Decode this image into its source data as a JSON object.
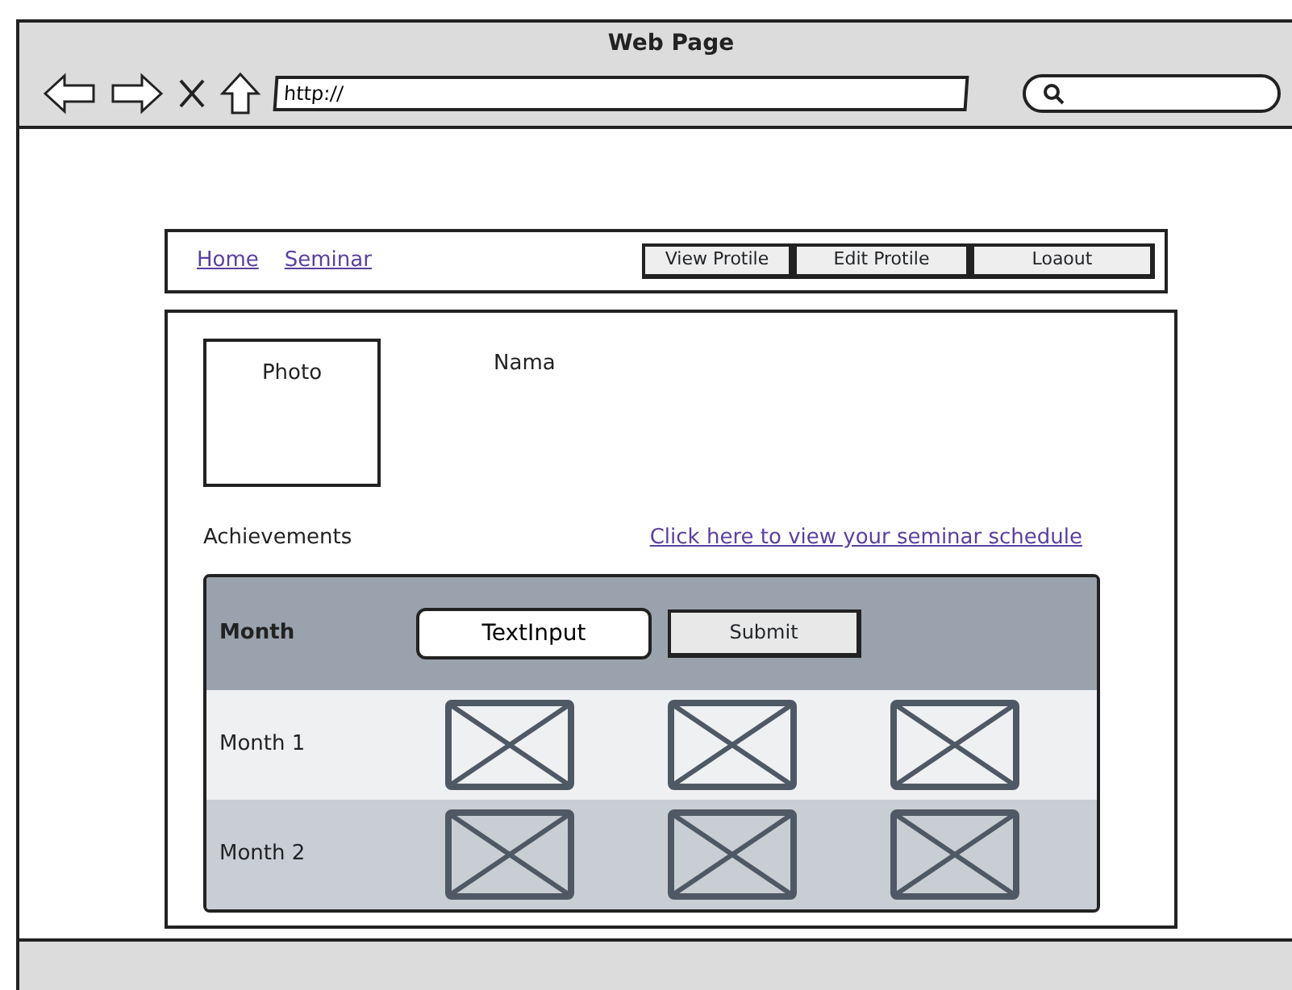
{
  "window": {
    "title": "Web Page",
    "url": "http://"
  },
  "nav": {
    "links": [
      {
        "label": "Home"
      },
      {
        "label": "Seminar"
      }
    ],
    "buttons": [
      "View Protile",
      "Edit Protile",
      "Loaout"
    ]
  },
  "profile": {
    "photo_label": "Photo",
    "name_label": "Nama"
  },
  "achievements_label": "Achievements",
  "schedule_link": "Click here to view your seminar schedule",
  "table": {
    "header": {
      "label": "Month",
      "input_value": "TextInput",
      "button": "Submit"
    },
    "rows": [
      {
        "label": "Month 1"
      },
      {
        "label": "Month 2"
      }
    ]
  }
}
